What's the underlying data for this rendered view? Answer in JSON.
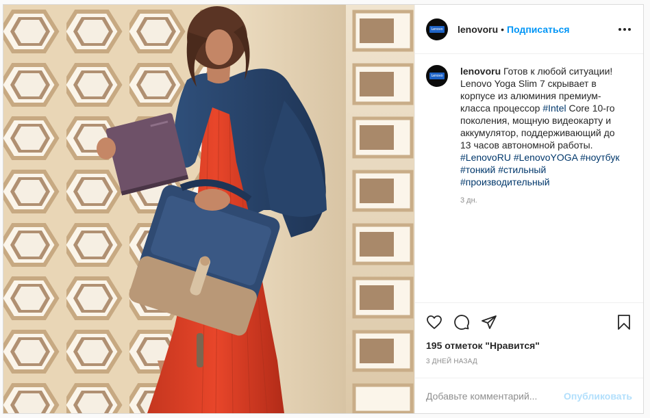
{
  "post": {
    "username": "lenovoru",
    "follow_label": "Подписаться",
    "dot": "•",
    "avatar_text": "Lenovo",
    "caption": {
      "username": "lenovoru",
      "text": "Готов к любой ситуации! Lenovo Yoga Slim 7 скрывает в корпусе из алюминия премиум-класса процессор ",
      "tag_intel": "#Intel",
      "text2": " Core 10-го поколения, мощную видеокарту и аккумулятор, поддерживающий до 13 часов автономной работы. ",
      "hashtags": [
        "#LenovoRU",
        "#LenovoYOGA",
        "#ноутбук",
        "#тонкий",
        "#стильный",
        "#производительный"
      ],
      "time": "3 дн."
    },
    "likes": "195 отметок \"Нравится\"",
    "date": "3 ДНЕЙ НАЗАД",
    "comment_placeholder": "Добавьте комментарий...",
    "publish_label": "Опубликовать"
  },
  "colors": {
    "accent": "#0095f6",
    "publish_disabled": "#b2dffc",
    "hashtag": "#00376b",
    "muted": "#8e8e8e"
  },
  "icons": [
    "more-icon",
    "heart-icon",
    "comment-icon",
    "share-icon",
    "bookmark-icon"
  ]
}
